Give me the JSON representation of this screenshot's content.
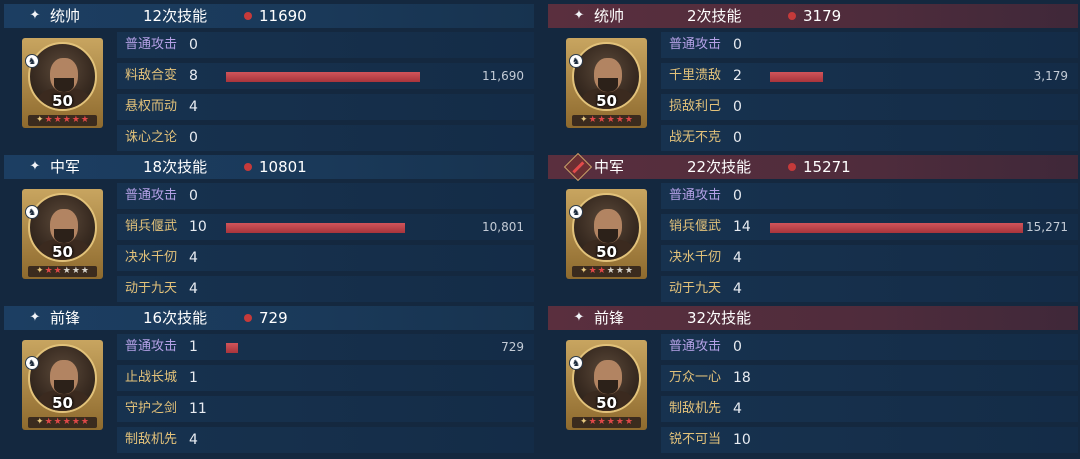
{
  "left": [
    {
      "role": "统帅",
      "role_icon": "sparkle-icon",
      "casts": "12次技能",
      "total": "11690",
      "level": "50",
      "stars": [
        "red",
        "red",
        "red",
        "red",
        "red"
      ],
      "skills": [
        {
          "name": "普通攻击",
          "count": "0",
          "type": "normal",
          "damage": "",
          "bar": 0
        },
        {
          "name": "料敌合变",
          "count": "8",
          "type": "tactic",
          "damage": "11,690",
          "bar": 11690
        },
        {
          "name": "悬权而动",
          "count": "4",
          "type": "tactic",
          "damage": "",
          "bar": 0
        },
        {
          "name": "诛心之论",
          "count": "0",
          "type": "tactic",
          "damage": "",
          "bar": 0
        }
      ]
    },
    {
      "role": "中军",
      "role_icon": "sparkle-icon",
      "casts": "18次技能",
      "total": "10801",
      "level": "50",
      "stars": [
        "red",
        "red",
        "grey",
        "grey",
        "grey"
      ],
      "skills": [
        {
          "name": "普通攻击",
          "count": "0",
          "type": "normal",
          "damage": "",
          "bar": 0
        },
        {
          "name": "销兵偃武",
          "count": "10",
          "type": "tactic",
          "damage": "10,801",
          "bar": 10801
        },
        {
          "name": "决水千仞",
          "count": "4",
          "type": "tactic",
          "damage": "",
          "bar": 0
        },
        {
          "name": "动于九天",
          "count": "4",
          "type": "tactic",
          "damage": "",
          "bar": 0
        }
      ]
    },
    {
      "role": "前锋",
      "role_icon": "sparkle-icon",
      "casts": "16次技能",
      "total": "729",
      "level": "50",
      "stars": [
        "red",
        "red",
        "red",
        "red",
        "red"
      ],
      "skills": [
        {
          "name": "普通攻击",
          "count": "1",
          "type": "normal",
          "damage": "729",
          "bar": 729
        },
        {
          "name": "止战长城",
          "count": "1",
          "type": "tactic",
          "damage": "",
          "bar": 0
        },
        {
          "name": "守护之剑",
          "count": "11",
          "type": "tactic",
          "damage": "",
          "bar": 0
        },
        {
          "name": "制敌机先",
          "count": "4",
          "type": "tactic",
          "damage": "",
          "bar": 0
        }
      ]
    }
  ],
  "right": [
    {
      "role": "统帅",
      "role_icon": "sparkle-icon",
      "casts": "2次技能",
      "total": "3179",
      "level": "50",
      "stars": [
        "red",
        "red",
        "red",
        "red",
        "red"
      ],
      "skills": [
        {
          "name": "普通攻击",
          "count": "0",
          "type": "normal",
          "damage": "",
          "bar": 0
        },
        {
          "name": "千里溃敌",
          "count": "2",
          "type": "tactic",
          "damage": "3,179",
          "bar": 3179
        },
        {
          "name": "损敌利己",
          "count": "0",
          "type": "tactic",
          "damage": "",
          "bar": 0
        },
        {
          "name": "战无不克",
          "count": "0",
          "type": "tactic",
          "damage": "",
          "bar": 0
        }
      ]
    },
    {
      "role": "中军",
      "role_icon": "sword-diamond-icon",
      "casts": "22次技能",
      "total": "15271",
      "level": "50",
      "stars": [
        "red",
        "red",
        "grey",
        "grey",
        "grey"
      ],
      "skills": [
        {
          "name": "普通攻击",
          "count": "0",
          "type": "normal",
          "damage": "",
          "bar": 0
        },
        {
          "name": "销兵偃武",
          "count": "14",
          "type": "tactic",
          "damage": "15,271",
          "bar": 15271
        },
        {
          "name": "决水千仞",
          "count": "4",
          "type": "tactic",
          "damage": "",
          "bar": 0
        },
        {
          "name": "动于九天",
          "count": "4",
          "type": "tactic",
          "damage": "",
          "bar": 0
        }
      ]
    },
    {
      "role": "前锋",
      "role_icon": "sparkle-icon",
      "casts": "32次技能",
      "total": "",
      "level": "50",
      "stars": [
        "red",
        "red",
        "red",
        "red",
        "red"
      ],
      "skills": [
        {
          "name": "普通攻击",
          "count": "0",
          "type": "normal",
          "damage": "",
          "bar": 0
        },
        {
          "name": "万众一心",
          "count": "18",
          "type": "tactic",
          "damage": "",
          "bar": 0
        },
        {
          "name": "制敌机先",
          "count": "4",
          "type": "tactic",
          "damage": "",
          "bar": 0
        },
        {
          "name": "锐不可当",
          "count": "10",
          "type": "tactic",
          "damage": "",
          "bar": 0
        }
      ]
    }
  ],
  "colors": {
    "damage_bar": "#c0434a",
    "damage_dot": "#c63a3a",
    "normal_attack": "#b4a1e6",
    "tactic_skill": "#e3c27a",
    "frame_gold": "#c8a560"
  }
}
